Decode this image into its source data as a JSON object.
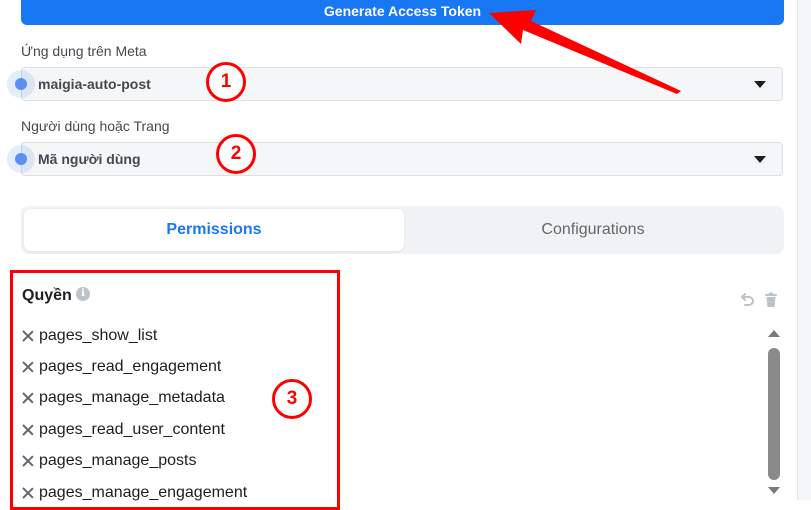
{
  "header": {
    "generate_label": "Generate Access Token"
  },
  "fields": {
    "app": {
      "label": "Ứng dụng trên Meta",
      "value": "maigia-auto-post"
    },
    "user_or_page": {
      "label": "Người dùng hoặc Trang",
      "value": "Mã người dùng"
    }
  },
  "badges": [
    "1",
    "2",
    "3"
  ],
  "tabs": [
    {
      "label": "Permissions",
      "active": true
    },
    {
      "label": "Configurations",
      "active": false
    }
  ],
  "permissions": {
    "title": "Quyền",
    "items": [
      "pages_show_list",
      "pages_read_engagement",
      "pages_manage_metadata",
      "pages_read_user_content",
      "pages_manage_posts",
      "pages_manage_engagement"
    ]
  },
  "colors": {
    "brand": "#1877f2",
    "annotation": "#ff0000"
  },
  "icons": {
    "info": "info-icon",
    "undo": "undo-icon",
    "trash": "trash-icon",
    "remove": "close-icon",
    "caret": "caret-down-icon"
  }
}
